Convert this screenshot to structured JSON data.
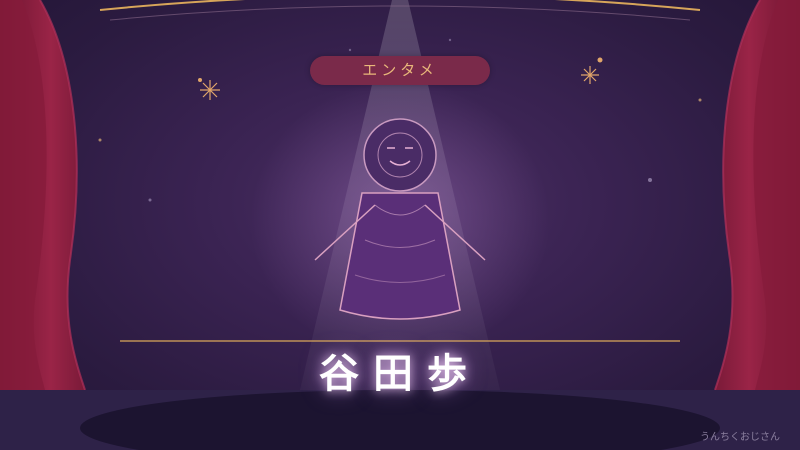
{
  "badge": {
    "label": "エンタメ"
  },
  "person": {
    "name": "谷田歩"
  },
  "credit": {
    "text": "うんちくおじさん"
  },
  "colors": {
    "background": "#2b1b40",
    "curtain": "#8b1e3f",
    "badge_bg": "#7a2a4a",
    "badge_text": "#e9b87a",
    "gold_line": "#d7a55a",
    "figure_body": "#5a2f78",
    "figure_outline": "#d9a0c0"
  },
  "icons": {
    "sparkles": "sparkle-icon",
    "figure": "person-silhouette-icon"
  }
}
